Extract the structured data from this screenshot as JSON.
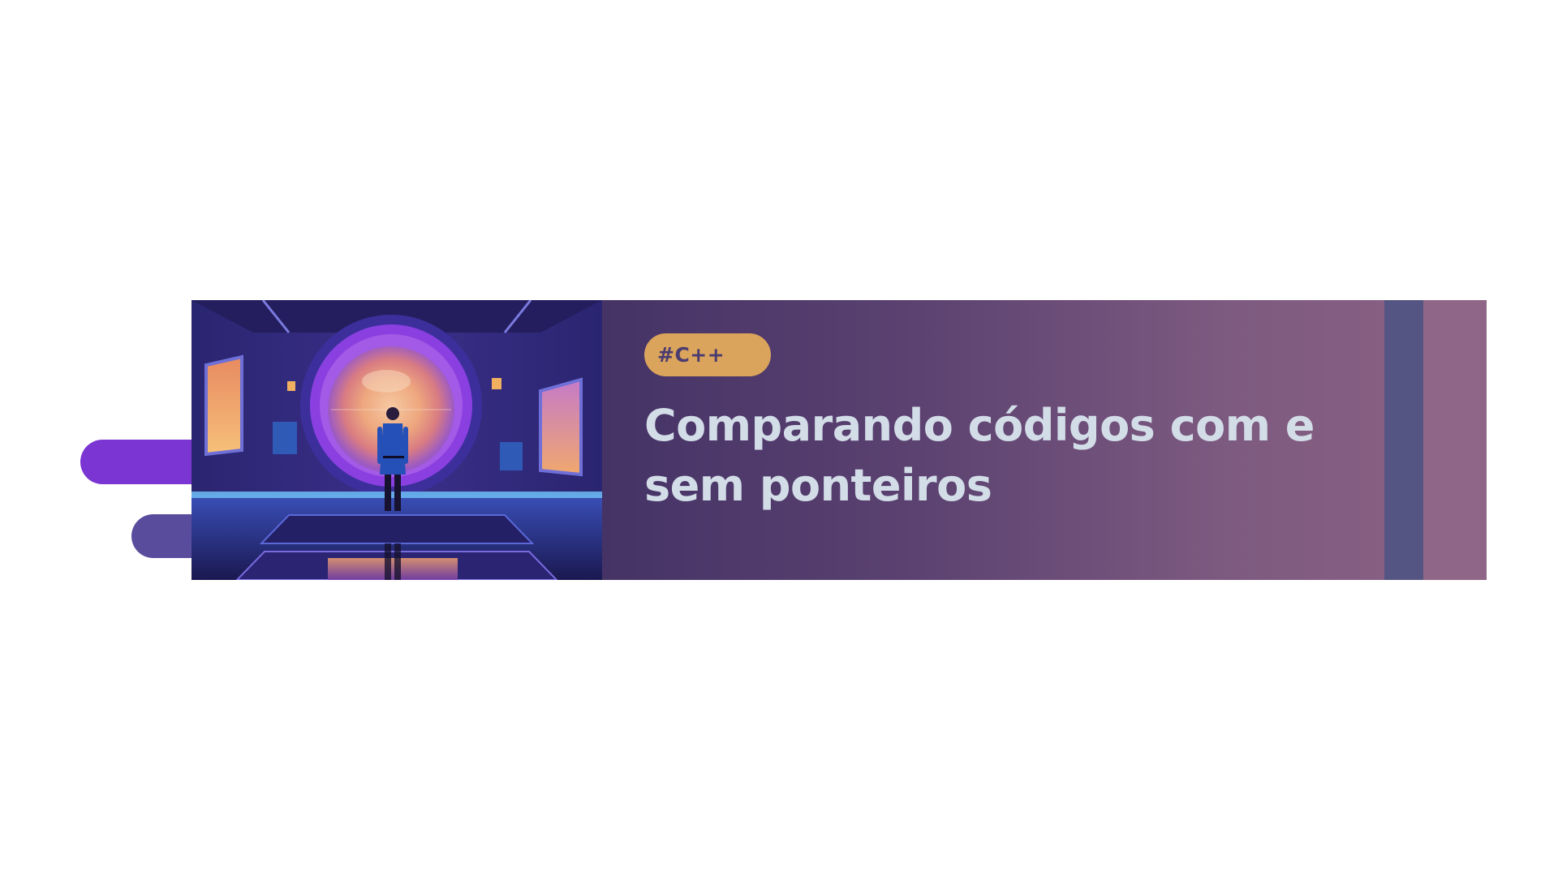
{
  "banner": {
    "tag": "#C++",
    "title": "Comparando códigos com e sem ponteiros"
  },
  "colors": {
    "tag_bg": "#dba45c",
    "tag_text": "#4a3c70",
    "title_text": "#d3dde8",
    "gradient_start": "#2c2455",
    "gradient_end": "#8c6284",
    "pill_purple": "#7b35d2",
    "pill_slate": "#5a4c9c",
    "stripe_blue": "#555583",
    "stripe_mauve": "#8f6687"
  },
  "illustration": {
    "subject": "figure-in-space-station-portal"
  }
}
